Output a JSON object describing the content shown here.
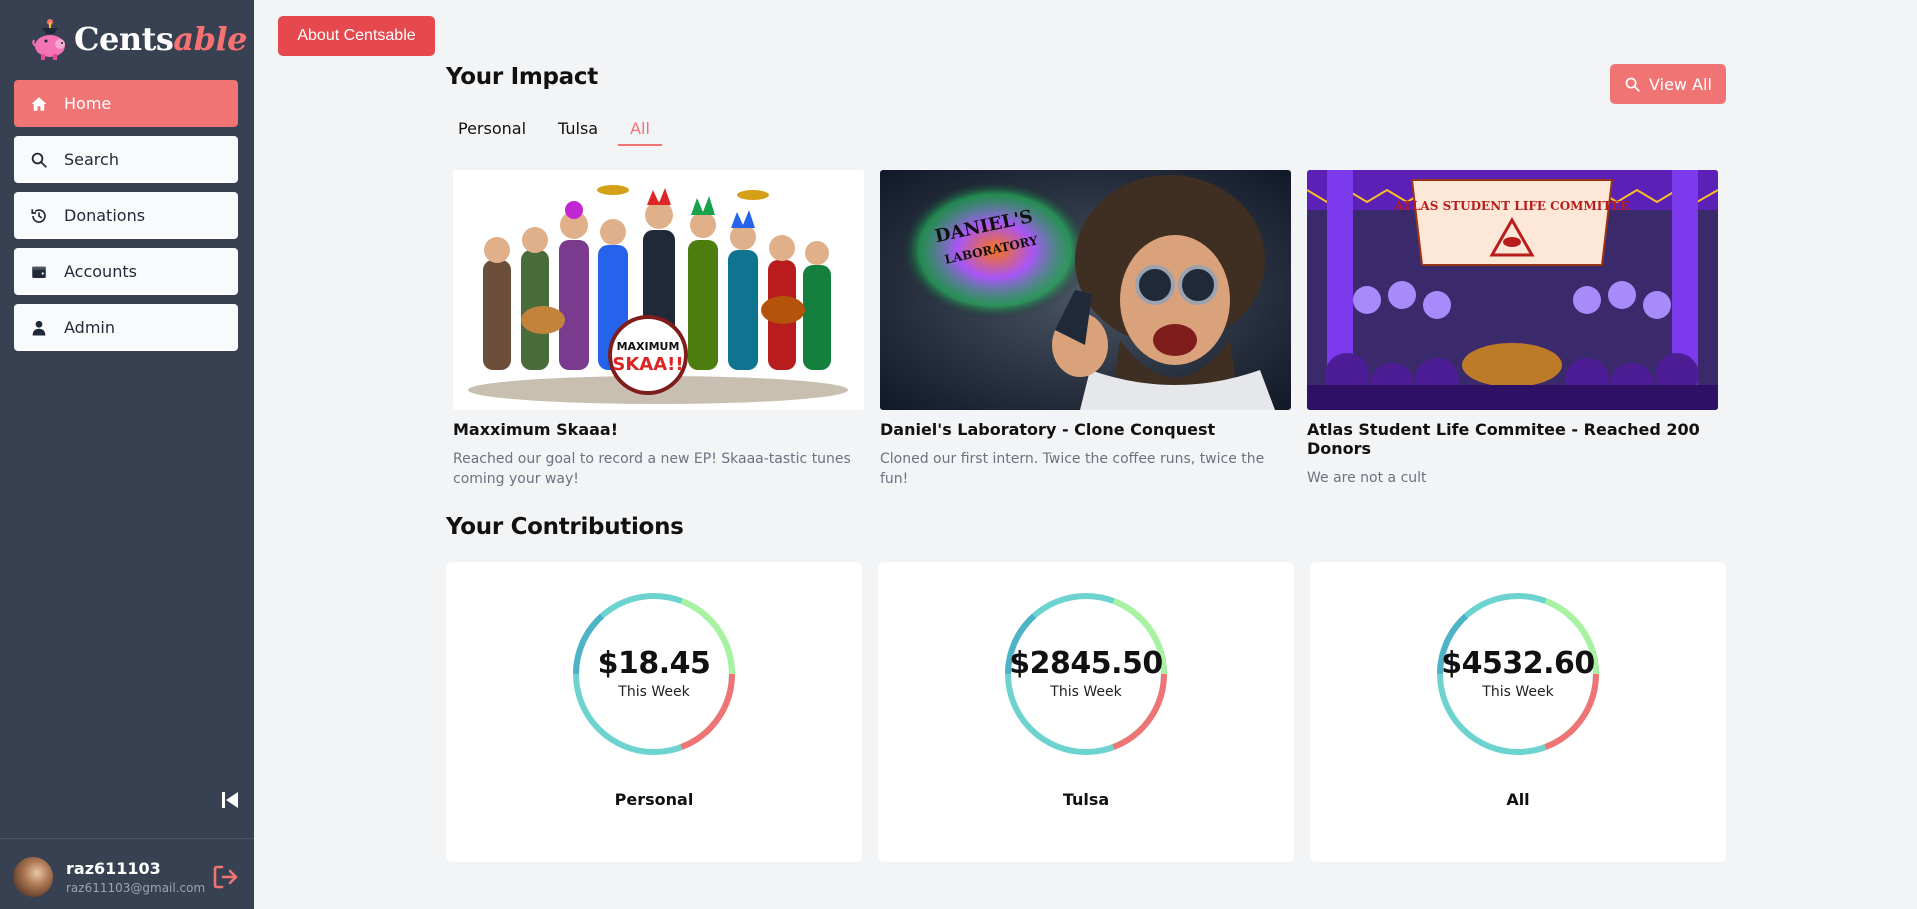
{
  "app": {
    "logo_part1": "Cents",
    "logo_part2": "able"
  },
  "sidebar": {
    "items": [
      {
        "label": "Home",
        "icon": "home-icon"
      },
      {
        "label": "Search",
        "icon": "search-icon"
      },
      {
        "label": "Donations",
        "icon": "history-icon"
      },
      {
        "label": "Accounts",
        "icon": "wallet-icon"
      },
      {
        "label": "Admin",
        "icon": "user-icon"
      }
    ],
    "active": "Home"
  },
  "user": {
    "name": "raz611103",
    "email": "raz611103@gmail.com"
  },
  "header": {
    "about_label": "About Centsable"
  },
  "impact": {
    "title": "Your Impact",
    "view_all_label": "View All",
    "tabs": [
      "Personal",
      "Tulsa",
      "All"
    ],
    "active_tab": "All",
    "cards": [
      {
        "title": "Maxximum Skaaa!",
        "description": "Reached our goal to record a new EP! Skaaa-tastic tunes coming your way!",
        "image_text_1": "MAXIMUM",
        "image_text_2": "SKAA!!"
      },
      {
        "title": "Daniel's Laboratory - Clone Conquest",
        "description": "Cloned our first intern. Twice the coffee runs, twice the fun!",
        "image_text_1": "DANIEL'S",
        "image_text_2": "LABORATORY"
      },
      {
        "title": "Atlas Student Life Commitee - Reached 200 Donors",
        "description": "We are not a cult",
        "image_text_1": "ATLAS STUDENT LIFE COMMITEE"
      }
    ]
  },
  "contributions": {
    "title": "Your Contributions",
    "items": [
      {
        "amount": "$18.45",
        "period": "This Week",
        "label": "Personal"
      },
      {
        "amount": "$2845.50",
        "period": "This Week",
        "label": "Tulsa"
      },
      {
        "amount": "$4532.60",
        "period": "This Week",
        "label": "All"
      }
    ]
  },
  "colors": {
    "accent": "#f07474",
    "about_button": "#e5484d",
    "sidebar": "#374151",
    "donut_teal": "#6dd3cf",
    "donut_blue": "#4fb3c8",
    "donut_green": "#a7f3a0",
    "donut_red": "#f07474"
  }
}
